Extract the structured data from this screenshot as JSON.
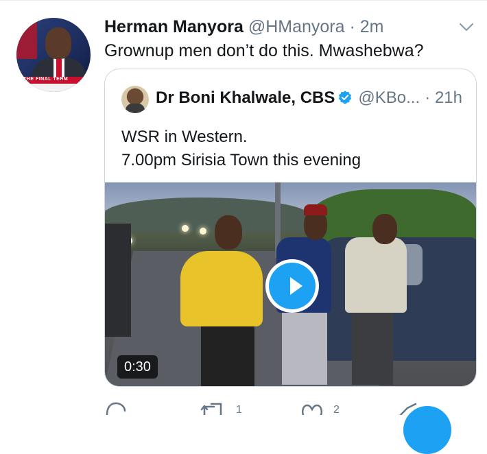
{
  "tweet": {
    "author_name": "Herman Manyora",
    "author_handle": "@HManyora",
    "separator": "·",
    "time": "2m",
    "text": "Grownup men don’t do this. Mwashebwa?",
    "avatar_banner_text": "THE FINAL TERM"
  },
  "quoted_tweet": {
    "author_name": "Dr Boni Khalwale, CBS",
    "author_handle": "@KBo...",
    "separator": "·",
    "time": "21h",
    "verified": true,
    "text_line1": "WSR in Western.",
    "text_line2": "7.00pm Sirisia Town this evening",
    "video": {
      "duration": "0:30"
    }
  },
  "actions": {
    "retweet_count": "1",
    "like_count": "2"
  },
  "colors": {
    "accent": "#1da1f2",
    "secondary_text": "#657786",
    "border": "#ccd6dd"
  },
  "icons": [
    "chevron-down-icon",
    "verified-badge-icon",
    "play-icon",
    "reply-icon",
    "retweet-icon",
    "like-icon",
    "share-icon"
  ]
}
